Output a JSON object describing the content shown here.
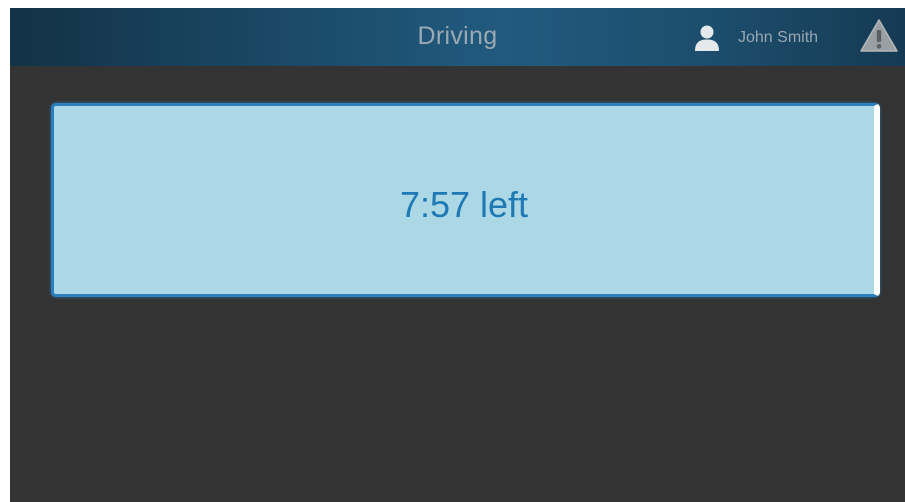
{
  "header": {
    "title": "Driving",
    "user": {
      "icon": "user-icon",
      "name": "John Smith"
    },
    "alert": {
      "icon": "warning-icon"
    }
  },
  "timer": {
    "text": "7:57 left"
  },
  "colors": {
    "background": "#333333",
    "header_accent": "#215a7e",
    "card_fill": "#acd8e6",
    "card_border": "#2c7fbe",
    "timer_text": "#1e79b5"
  }
}
